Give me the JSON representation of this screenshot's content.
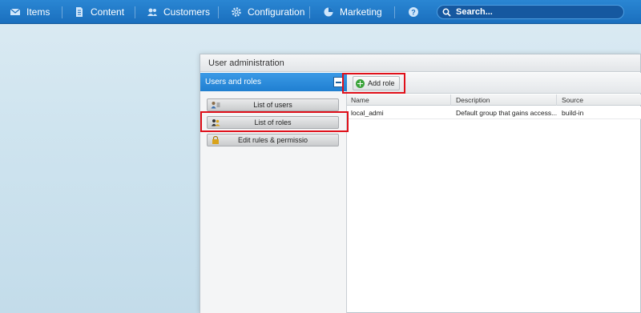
{
  "nav": {
    "items": [
      {
        "label": "Items",
        "icon": "mail-icon"
      },
      {
        "label": "Content",
        "icon": "document-icon"
      },
      {
        "label": "Customers",
        "icon": "people-icon"
      },
      {
        "label": "Configuration",
        "icon": "gear-icon"
      },
      {
        "label": "Marketing",
        "icon": "pie-chart-icon"
      }
    ],
    "help_icon": "question-icon",
    "search_placeholder": "Search..."
  },
  "window": {
    "title": "User administration"
  },
  "left_panel": {
    "header": "Users and roles",
    "buttons": [
      {
        "label": "List of users",
        "icon": "users-list-icon"
      },
      {
        "label": "List of roles",
        "icon": "roles-icon"
      },
      {
        "label": "Edit rules & permissio",
        "icon": "lock-icon"
      }
    ]
  },
  "toolbar": {
    "add_role_label": "Add role"
  },
  "grid": {
    "columns": [
      "Name",
      "Description",
      "Source"
    ],
    "rows": [
      {
        "name": "local_admi",
        "description": "Default group that gains access...",
        "source": "build-in"
      }
    ]
  },
  "colors": {
    "nav_blue": "#1a6fbe",
    "panel_header_blue": "#1f7fd1",
    "highlight_red": "#e0101a",
    "add_green": "#3aa33a"
  }
}
